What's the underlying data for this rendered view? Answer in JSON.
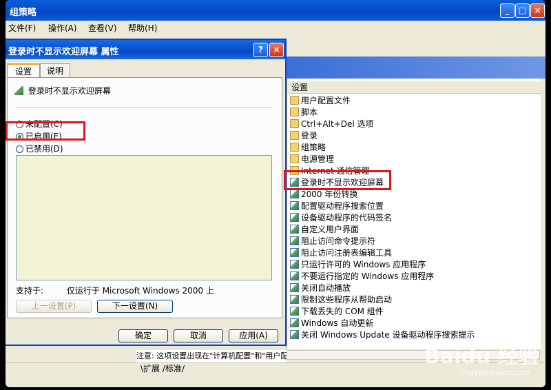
{
  "main_window": {
    "title": "组策略",
    "minimize": "_",
    "maximize": "□",
    "close": "×",
    "menu": [
      "文件(F)",
      "操作(A)",
      "查看(V)",
      "帮助(H)"
    ]
  },
  "right_pane": {
    "column_header": "设置",
    "items": [
      {
        "label": "用户配置文件",
        "icon": "folder-icon"
      },
      {
        "label": "脚本",
        "icon": "folder-icon"
      },
      {
        "label": "Ctrl+Alt+Del 选项",
        "icon": "folder-icon"
      },
      {
        "label": "登录",
        "icon": "folder-icon"
      },
      {
        "label": "组策略",
        "icon": "folder-icon"
      },
      {
        "label": "电源管理",
        "icon": "folder-icon"
      },
      {
        "label": "Internet 通信管理",
        "icon": "folder-icon"
      },
      {
        "label": "登录时不显示欢迎屏幕",
        "icon": "policy-setting-icon"
      },
      {
        "label": "2000 年份转换",
        "icon": "policy-setting-icon"
      },
      {
        "label": "配置驱动程序搜索位置",
        "icon": "policy-setting-icon"
      },
      {
        "label": "设备驱动程序的代码签名",
        "icon": "policy-setting-icon"
      },
      {
        "label": "自定义用户界面",
        "icon": "policy-setting-icon"
      },
      {
        "label": "阻止访问命令提示符",
        "icon": "policy-setting-icon"
      },
      {
        "label": "阻止访问注册表编辑工具",
        "icon": "policy-setting-icon"
      },
      {
        "label": "只运行许可的 Windows 应用程序",
        "icon": "policy-setting-icon"
      },
      {
        "label": "不要运行指定的 Windows 应用程序",
        "icon": "policy-setting-icon"
      },
      {
        "label": "关闭自动播放",
        "icon": "policy-setting-icon"
      },
      {
        "label": "限制这些程序从帮助启动",
        "icon": "policy-setting-icon"
      },
      {
        "label": "下载丢失的 COM 组件",
        "icon": "policy-setting-icon"
      },
      {
        "label": "Windows 自动更新",
        "icon": "policy-setting-icon"
      },
      {
        "label": "关闭 Windows Update 设备驱动程序搜索提示",
        "icon": "policy-setting-icon"
      }
    ]
  },
  "left_pane": {
    "note_text": "注意: 这项设置出现在\"计算机配置\"和\"用户配置\"文件夹中。如"
  },
  "bottom_tabs": [
    "扩展",
    "标准"
  ],
  "dialog": {
    "title": "登录时不显示欢迎屏幕 属性",
    "help": "?",
    "close": "×",
    "tabs": [
      "设置",
      "说明"
    ],
    "policy_name": "登录时不显示欢迎屏幕",
    "options": [
      "未配置(C)",
      "已启用(E)",
      "已禁用(D)"
    ],
    "selected_option": "已启用(E)",
    "support_label": "支持于:",
    "support_value": "仅运行于 Microsoft Windows 2000 上",
    "prev_button": "上一设置(P)",
    "next_button": "下一设置(N)",
    "ok_button": "确定",
    "cancel_button": "取消",
    "apply_button": "应用(A)"
  },
  "watermark": {
    "brand": "Baidu 经验",
    "url": "jingyan.baidu.com"
  },
  "colors": {
    "xp_title_blue": "#0347c2",
    "highlight_red": "#e0141a",
    "dialog_bg": "#ece9d8"
  }
}
